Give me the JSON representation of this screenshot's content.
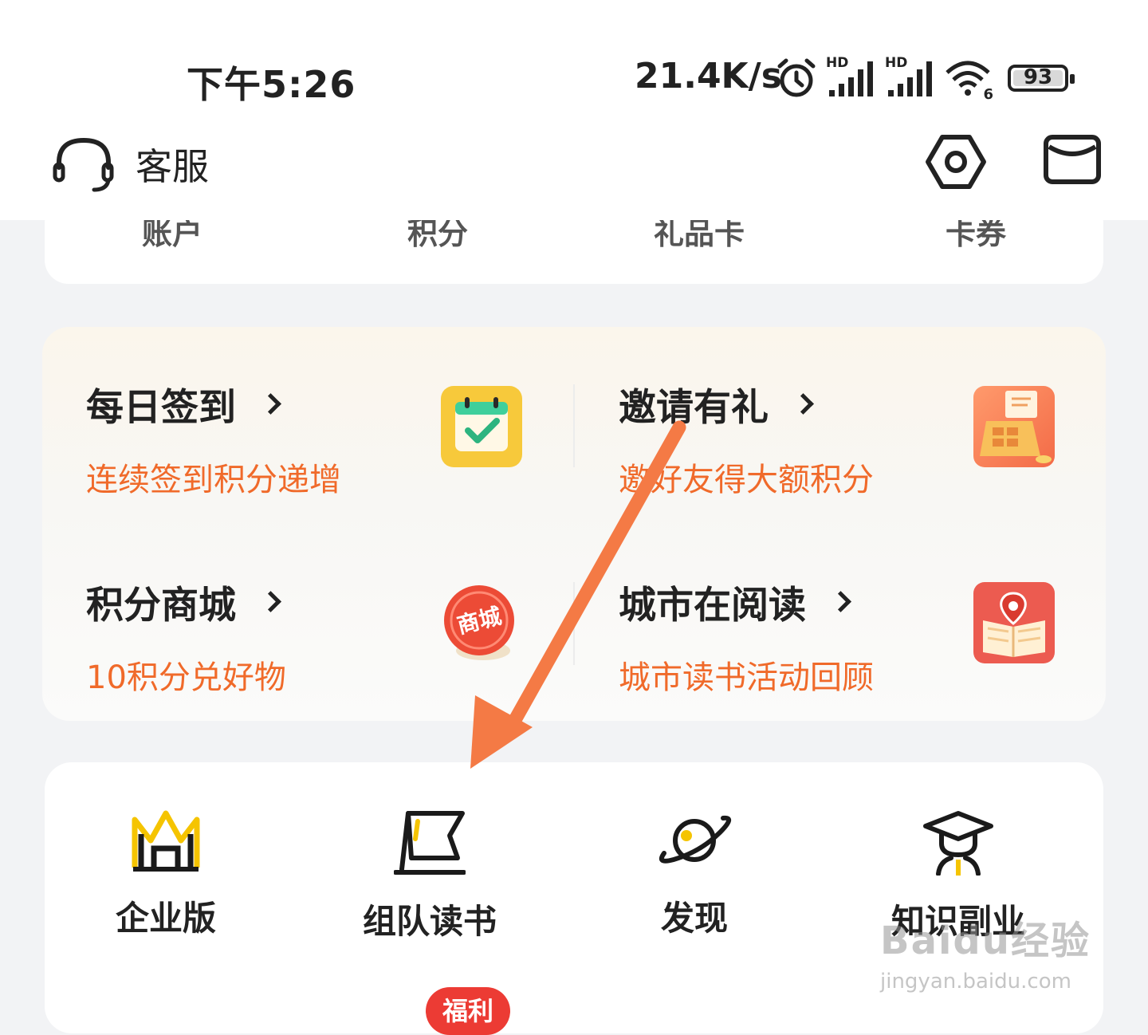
{
  "status_bar": {
    "time": "下午5:26",
    "network_speed": "21.4K/s",
    "signal_1_label": "HD",
    "signal_2_label": "HD",
    "wifi_label": "6",
    "battery": "93"
  },
  "header": {
    "customer_service_label": "客服",
    "icons": [
      "headset-icon",
      "settings-icon",
      "mail-icon"
    ]
  },
  "top_card": {
    "labels": [
      "账户",
      "积分",
      "礼品卡",
      "卡券"
    ]
  },
  "benefits": {
    "items": [
      {
        "title": "每日签到",
        "subtitle": "连续签到积分递增",
        "icon": "calendar-check-icon"
      },
      {
        "title": "邀请有礼",
        "subtitle": "邀好友得大额积分",
        "icon": "gift-register-icon"
      },
      {
        "title": "积分商城",
        "subtitle": "10积分兑好物",
        "icon": "mall-badge-icon",
        "icon_text": "商城"
      },
      {
        "title": "城市在阅读",
        "subtitle": "城市读书活动回顾",
        "icon": "map-book-icon"
      }
    ]
  },
  "quick_actions": {
    "items": [
      {
        "label": "企业版",
        "icon": "enterprise-icon"
      },
      {
        "label": "组队读书",
        "icon": "team-flag-icon"
      },
      {
        "label": "发现",
        "icon": "planet-icon"
      },
      {
        "label": "知识副业",
        "icon": "graduation-cap-icon"
      }
    ],
    "badge": "福利"
  },
  "watermark": {
    "main": "Baidu经验",
    "sub": "jingyan.baidu.com"
  },
  "colors": {
    "accent_orange": "#f06a2a",
    "arrow": "#f47a45",
    "badge_red": "#ec3b34",
    "brand_yellow": "#f5c400"
  }
}
